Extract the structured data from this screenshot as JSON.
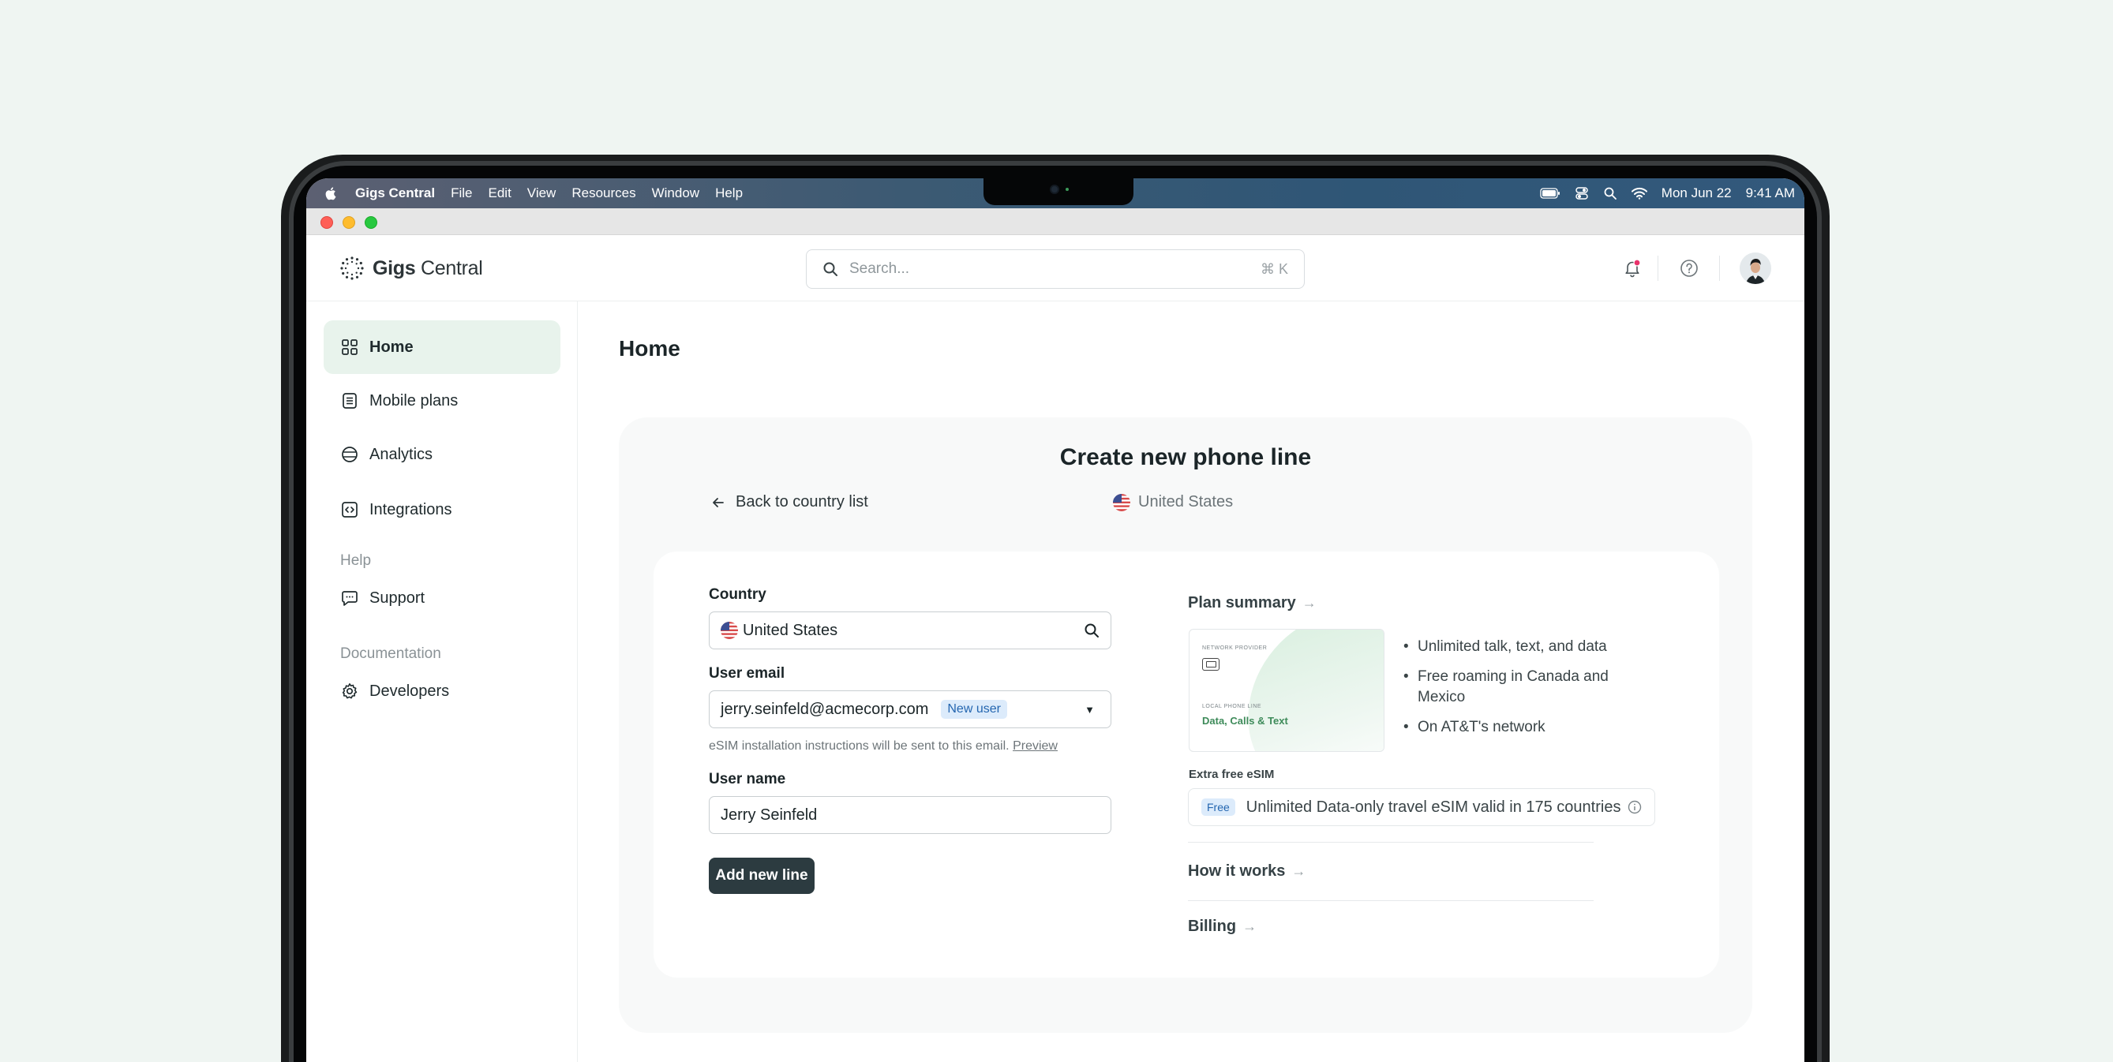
{
  "menubar": {
    "app_name": "Gigs Central",
    "items": [
      "File",
      "Edit",
      "View",
      "Resources",
      "Window",
      "Help"
    ],
    "date": "Mon Jun 22",
    "time": "9:41 AM"
  },
  "header": {
    "logo_text_bold": "Gigs",
    "logo_text_regular": "Central",
    "search_placeholder": "Search...",
    "search_shortcut": "⌘ K"
  },
  "sidebar": {
    "items": [
      {
        "label": "Home",
        "icon": "grid-icon",
        "active": true
      },
      {
        "label": "Mobile plans",
        "icon": "list-icon"
      },
      {
        "label": "Analytics",
        "icon": "globe-icon"
      },
      {
        "label": "Integrations",
        "icon": "code-icon"
      }
    ],
    "help_section": "Help",
    "help_items": [
      {
        "label": "Support",
        "icon": "chat-icon"
      }
    ],
    "docs_section": "Documentation",
    "docs_items": [
      {
        "label": "Developers",
        "icon": "gear-icon"
      }
    ]
  },
  "main": {
    "page_title": "Home",
    "panel_title": "Create new phone line",
    "back_link": "Back to country list",
    "selected_country": "United States",
    "form": {
      "country_label": "Country",
      "country_value": "United States",
      "email_label": "User email",
      "email_value": "jerry.seinfeld@acmecorp.com",
      "email_badge": "New user",
      "email_hint": "eSIM installation instructions will be sent to this email.",
      "email_hint_link": "Preview",
      "name_label": "User name",
      "name_value": "Jerry Seinfeld",
      "submit_label": "Add new line"
    },
    "summary": {
      "title": "Plan summary",
      "card_provider_label": "NETWORK PROVIDER",
      "card_line_label": "LOCAL PHONE LINE",
      "card_plan": "Data, Calls & Text",
      "bullets": [
        "Unlimited talk, text, and data",
        "Free roaming in Canada and Mexico",
        "On AT&T's network"
      ],
      "extra_label": "Extra free eSIM",
      "extra_badge": "Free",
      "extra_text": "Unlimited Data-only travel eSIM valid in 175 countries",
      "how_it_works": "How it works",
      "billing": "Billing"
    }
  },
  "colors": {
    "active_nav_bg": "#e8f3ec",
    "primary_button": "#2c3b40",
    "badge_bg": "#dcebfb",
    "badge_text": "#2466b0",
    "notification_dot": "#e8336b"
  }
}
